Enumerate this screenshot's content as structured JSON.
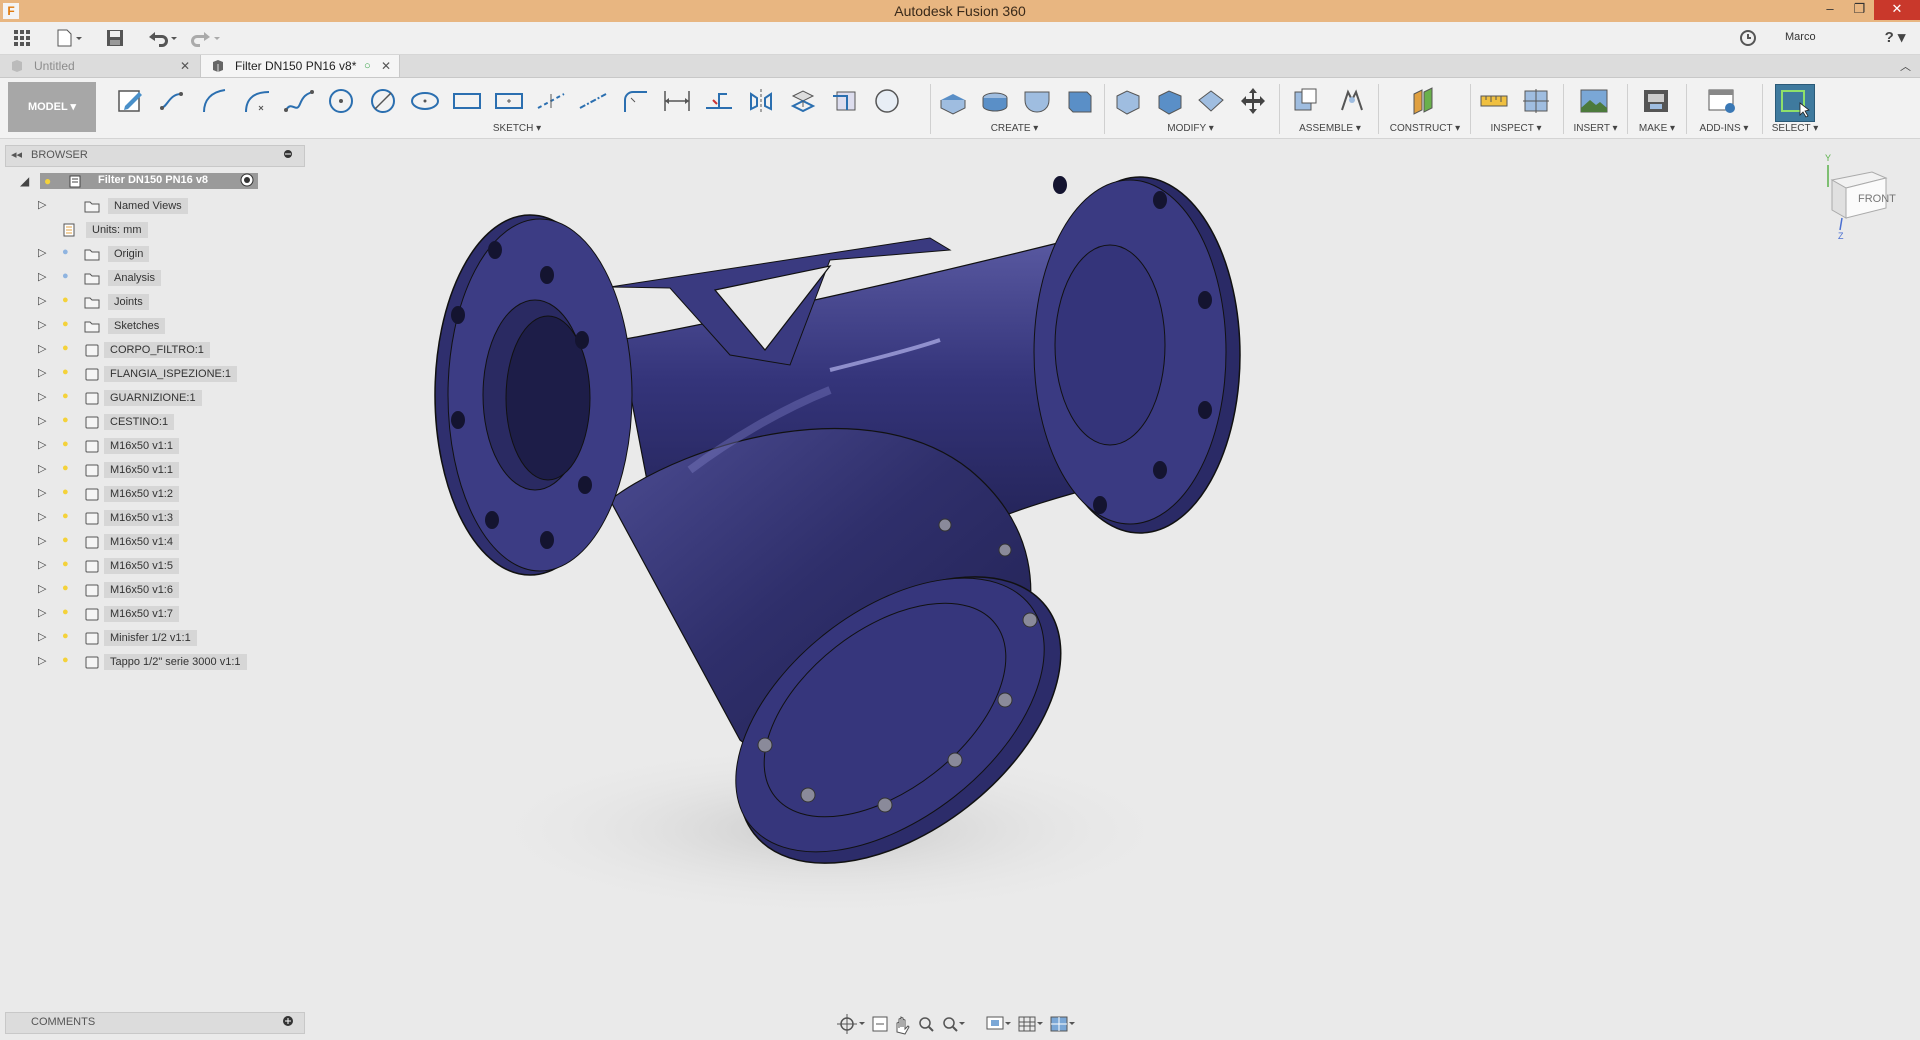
{
  "window": {
    "title": "Autodesk Fusion 360",
    "logo_letter": "F",
    "minimize": "–",
    "restore": "❐",
    "close": "✕"
  },
  "quickaccess": {
    "user": "Marco",
    "help": "?"
  },
  "tabs": [
    {
      "label": "Untitled",
      "close": "✕"
    },
    {
      "label": "Filter DN150 PN16 v8*",
      "close": "✕"
    }
  ],
  "toolbar": {
    "workspace": "MODEL ▾",
    "groups": {
      "sketch": "SKETCH ▾",
      "create": "CREATE ▾",
      "modify": "MODIFY ▾",
      "assemble": "ASSEMBLE ▾",
      "construct": "CONSTRUCT ▾",
      "inspect": "INSPECT ▾",
      "insert": "INSERT ▾",
      "make": "MAKE ▾",
      "addins": "ADD-INS ▾",
      "select": "SELECT ▾"
    }
  },
  "browser": {
    "header": "BROWSER",
    "root": "Filter DN150 PN16 v8",
    "items": [
      {
        "label": "Named Views"
      },
      {
        "label": "Units: mm"
      },
      {
        "label": "Origin"
      },
      {
        "label": "Analysis"
      },
      {
        "label": "Joints"
      },
      {
        "label": "Sketches"
      },
      {
        "label": "CORPO_FILTRO:1"
      },
      {
        "label": "FLANGIA_ISPEZIONE:1"
      },
      {
        "label": "GUARNIZIONE:1"
      },
      {
        "label": "CESTINO:1"
      },
      {
        "label": "M16x50 v1:1"
      },
      {
        "label": "M16x50 v1:1"
      },
      {
        "label": "M16x50 v1:2"
      },
      {
        "label": "M16x50 v1:3"
      },
      {
        "label": "M16x50 v1:4"
      },
      {
        "label": "M16x50 v1:5"
      },
      {
        "label": "M16x50 v1:6"
      },
      {
        "label": "M16x50 v1:7"
      },
      {
        "label": "Minisfer 1/2 v1:1"
      },
      {
        "label": "Tappo 1/2\" serie 3000 v1:1"
      }
    ]
  },
  "comments": {
    "header": "COMMENTS"
  },
  "viewcube": {
    "face": "FRONT",
    "axis_y": "Y",
    "axis_z": "Z"
  },
  "colors": {
    "titlebar": "#e8b681",
    "model_body": "#2e2e66",
    "select_accent": "#3f7a9e"
  }
}
